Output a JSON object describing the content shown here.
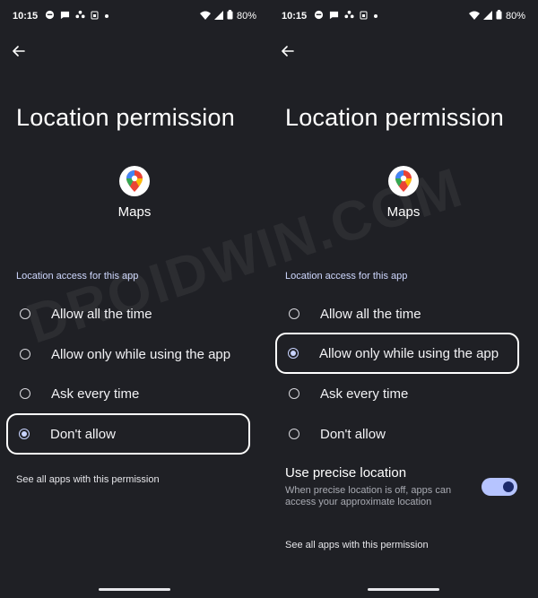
{
  "left": {
    "status": {
      "time": "10:15",
      "battery": "80%"
    },
    "title": "Location permission",
    "app_name": "Maps",
    "section_label": "Location access for this app",
    "options": [
      {
        "label": "Allow all the time",
        "selected": false
      },
      {
        "label": "Allow only while using the app",
        "selected": false
      },
      {
        "label": "Ask every time",
        "selected": false
      },
      {
        "label": "Don't allow",
        "selected": true
      }
    ],
    "see_all": "See all apps with this permission"
  },
  "right": {
    "status": {
      "time": "10:15",
      "battery": "80%"
    },
    "title": "Location permission",
    "app_name": "Maps",
    "section_label": "Location access for this app",
    "options": [
      {
        "label": "Allow all the time",
        "selected": false
      },
      {
        "label": "Allow only while using the app",
        "selected": true
      },
      {
        "label": "Ask every time",
        "selected": false
      },
      {
        "label": "Don't allow",
        "selected": false
      }
    ],
    "precise": {
      "title": "Use precise location",
      "description": "When precise location is off, apps can access your approximate location",
      "enabled": true
    },
    "see_all": "See all apps with this permission"
  },
  "watermark": "DROIDWIN.COM",
  "colors": {
    "background": "#1f2025",
    "accent": "#c9d4ff",
    "toggle_track": "#b6c4ff"
  }
}
